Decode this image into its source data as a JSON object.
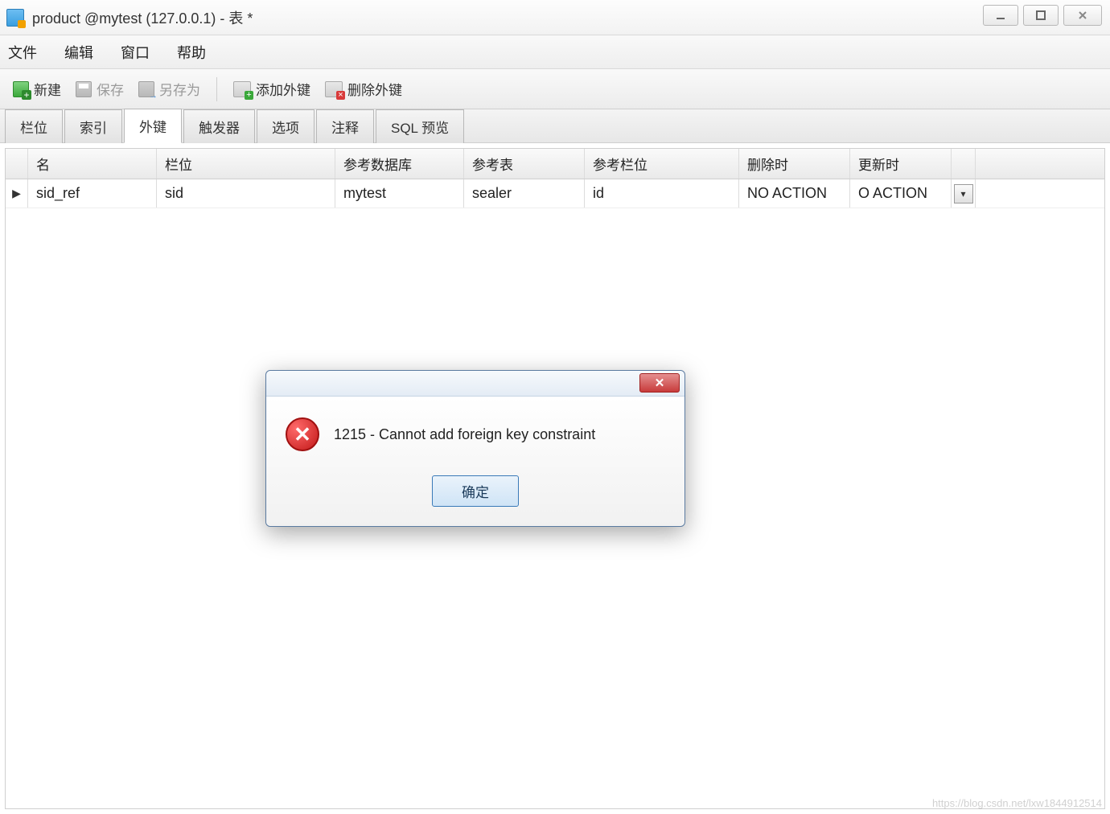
{
  "window": {
    "title": "product @mytest (127.0.0.1) - 表 *"
  },
  "menu": {
    "file": "文件",
    "edit": "编辑",
    "window": "窗口",
    "help": "帮助"
  },
  "toolbar": {
    "new": "新建",
    "save": "保存",
    "saveas": "另存为",
    "add_fk": "添加外键",
    "del_fk": "删除外键"
  },
  "tabs": {
    "columns": "栏位",
    "indexes": "索引",
    "fk": "外键",
    "triggers": "触发器",
    "options": "选项",
    "comment": "注释",
    "sqlpreview": "SQL 预览"
  },
  "table": {
    "headers": {
      "name": "名",
      "field": "栏位",
      "refdb": "参考数据库",
      "reftable": "参考表",
      "refcol": "参考栏位",
      "ondelete": "删除时",
      "onupdate": "更新时"
    },
    "rows": [
      {
        "name": "sid_ref",
        "field": "sid",
        "refdb": "mytest",
        "reftable": "sealer",
        "refcol": "id",
        "ondelete": "NO ACTION",
        "onupdate": "O ACTION"
      }
    ]
  },
  "dialog": {
    "message": "1215 - Cannot add foreign key constraint",
    "ok": "确定",
    "close_glyph": "✕"
  },
  "watermark": "http://blog.csdn.net/",
  "footer_watermark": "https://blog.csdn.net/lxw1844912514"
}
